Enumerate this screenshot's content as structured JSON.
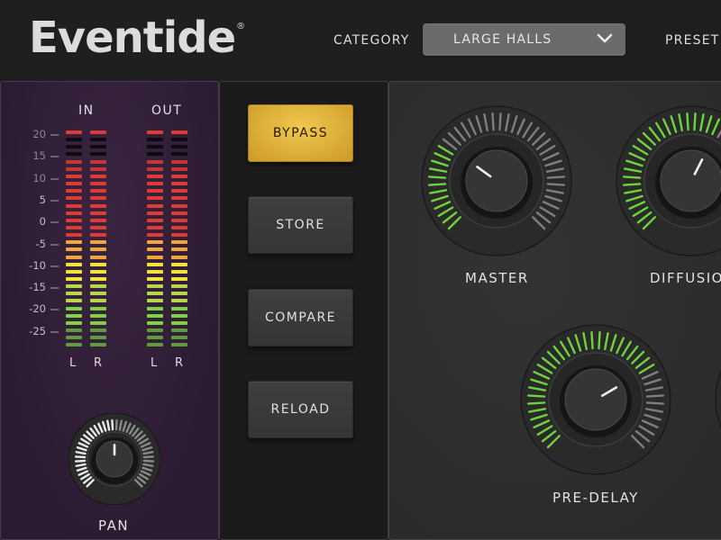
{
  "header": {
    "brand": "Eventide",
    "brand_mark": "®",
    "category_label": "CATEGORY",
    "category_value": "LARGE HALLS",
    "preset_label": "PRESET"
  },
  "meters": {
    "in_title": "IN",
    "out_title": "OUT",
    "scale": [
      "20",
      "15",
      "10",
      "5",
      "0",
      "-5",
      "-10",
      "-15",
      "-20",
      "-25"
    ],
    "channels": [
      "L",
      "R",
      "L",
      "R"
    ],
    "segments": 30,
    "lit_from_bottom": 26,
    "peak_hold": true,
    "colors": {
      "green_dark": "#5f9b3a",
      "green": "#7ed23f",
      "lime": "#b9d64a",
      "yellow": "#f3e23a",
      "orange": "#f2a53b",
      "red": "#e03a34",
      "dim_red": "#5a1a1e",
      "off": "#0e0a0f"
    }
  },
  "pan": {
    "label": "PAN",
    "value": 0.5
  },
  "buttons": [
    {
      "label": "BYPASS",
      "active": true
    },
    {
      "label": "STORE",
      "active": false
    },
    {
      "label": "COMPARE",
      "active": false
    },
    {
      "label": "RELOAD",
      "active": false
    }
  ],
  "knobs": [
    {
      "label": "MASTER",
      "value": 0.3
    },
    {
      "label": "DIFFUSION",
      "value": 0.6
    },
    {
      "label": "PRE-DELAY",
      "value": 0.72
    }
  ],
  "colors": {
    "accent_green": "#6ed23c",
    "tick_off": "#8d8d8d",
    "bypass_gold": "#e6b83e"
  }
}
